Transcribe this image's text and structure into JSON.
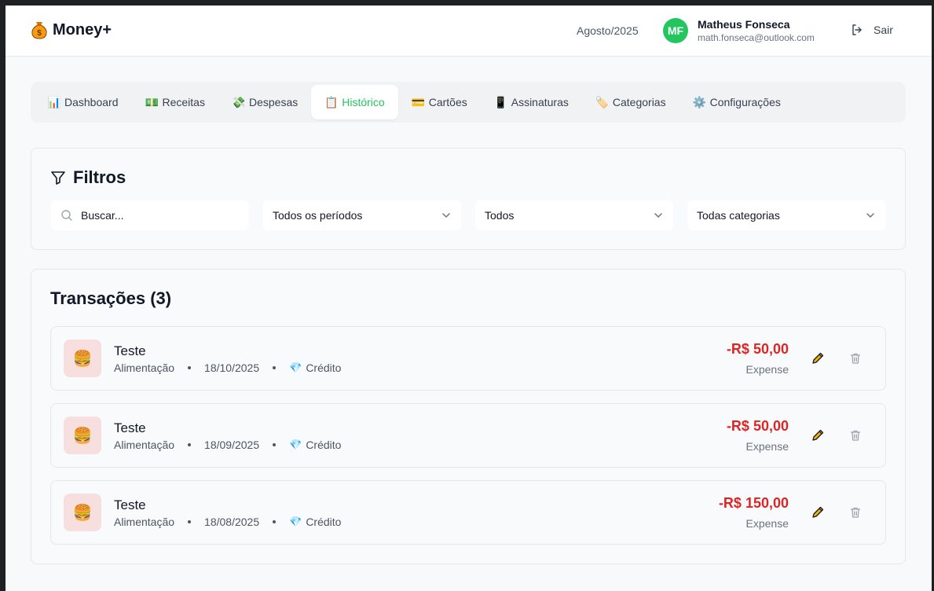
{
  "header": {
    "app_name": "Money+",
    "logo_icon": "money-bag-icon",
    "month": "Agosto/2025",
    "user": {
      "initials": "MF",
      "name": "Matheus Fonseca",
      "email": "math.fonseca@outlook.com",
      "avatar_color": "#22c55e"
    },
    "logout_label": "Sair"
  },
  "nav": {
    "tabs": [
      {
        "label": "Dashboard",
        "icon": "📊",
        "active": false
      },
      {
        "label": "Receitas",
        "icon": "💵",
        "active": false
      },
      {
        "label": "Despesas",
        "icon": "💸",
        "active": false
      },
      {
        "label": "Histórico",
        "icon": "📋",
        "active": true
      },
      {
        "label": "Cartões",
        "icon": "💳",
        "active": false
      },
      {
        "label": "Assinaturas",
        "icon": "📱",
        "active": false
      },
      {
        "label": "Categorias",
        "icon": "🏷️",
        "active": false
      },
      {
        "label": "Configurações",
        "icon": "⚙️",
        "active": false
      }
    ],
    "active_color": "#22c55e"
  },
  "filters": {
    "title": "Filtros",
    "search_placeholder": "Buscar...",
    "period_value": "Todos os períodos",
    "type_value": "Todos",
    "category_value": "Todas categorias"
  },
  "transactions": {
    "title": "Transações (3)",
    "items": [
      {
        "name": "Teste",
        "category": "Alimentação",
        "date": "18/10/2025",
        "payment": "Crédito",
        "amount": "-R$ 50,00",
        "type": "Expense",
        "icon": "🍔"
      },
      {
        "name": "Teste",
        "category": "Alimentação",
        "date": "18/09/2025",
        "payment": "Crédito",
        "amount": "-R$ 50,00",
        "type": "Expense",
        "icon": "🍔"
      },
      {
        "name": "Teste",
        "category": "Alimentação",
        "date": "18/08/2025",
        "payment": "Crédito",
        "amount": "-R$ 150,00",
        "type": "Expense",
        "icon": "🍔"
      }
    ],
    "expense_color": "#dc2626"
  }
}
